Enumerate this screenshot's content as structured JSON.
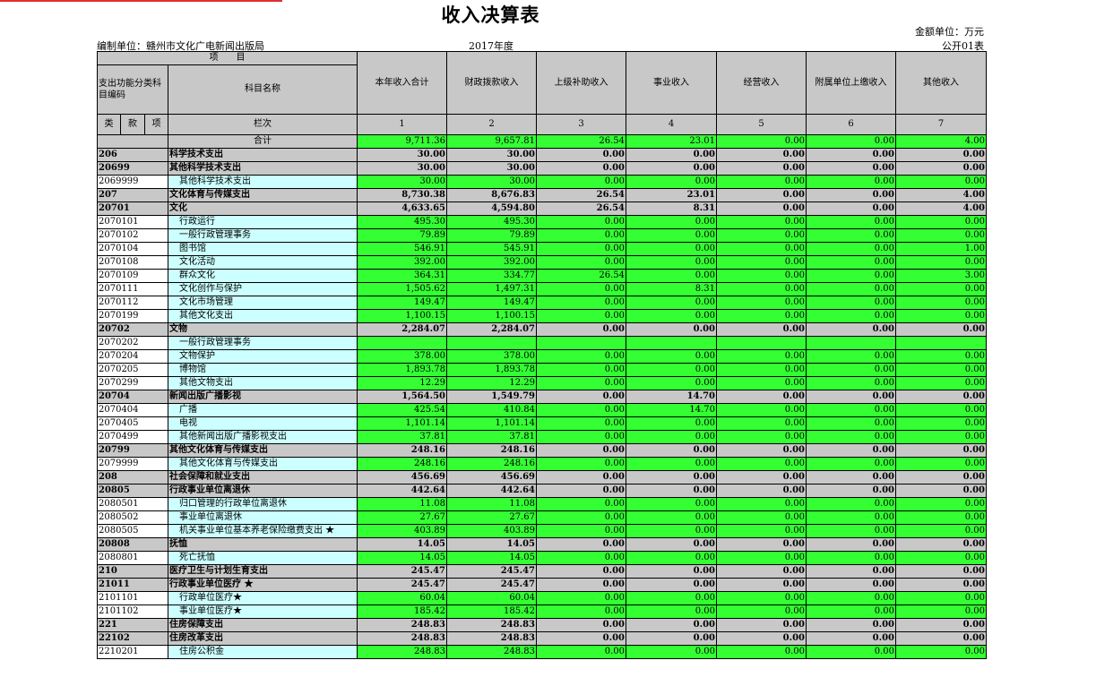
{
  "doc": {
    "title": "收入决算表",
    "unit": "金额单位：万元",
    "org": "编制单位：赣州市文化广电新闻出版局",
    "year": "2017年度",
    "form_no": "公开01表"
  },
  "header": {
    "project": "项　　目",
    "category_code": "支出功能分类科目编码",
    "subject_name": "科目名称",
    "lei": "类",
    "kuan": "款",
    "xiang": "项",
    "lanci": "栏次",
    "columns": [
      "本年收入合计",
      "财政拨款收入",
      "上级补助收入",
      "事业收入",
      "经营收入",
      "附属单位上缴收入",
      "其他收入"
    ],
    "col_nums": [
      "1",
      "2",
      "3",
      "4",
      "5",
      "6",
      "7"
    ]
  },
  "total": {
    "label": "合计",
    "values": [
      "9,711.36",
      "9,657.81",
      "26.54",
      "23.01",
      "0.00",
      "0.00",
      "4.00"
    ]
  },
  "rows": [
    {
      "code": "206",
      "name": "科学技术支出",
      "bold": true,
      "values": [
        "30.00",
        "30.00",
        "0.00",
        "0.00",
        "0.00",
        "0.00",
        "0.00"
      ]
    },
    {
      "code": "20699",
      "name": "其他科学技术支出",
      "bold": true,
      "values": [
        "30.00",
        "30.00",
        "0.00",
        "0.00",
        "0.00",
        "0.00",
        "0.00"
      ]
    },
    {
      "code": "2069999",
      "name": "其他科学技术支出",
      "bold": false,
      "values": [
        "30.00",
        "30.00",
        "0.00",
        "0.00",
        "0.00",
        "0.00",
        "0.00"
      ]
    },
    {
      "code": "207",
      "name": "文化体育与传媒支出",
      "bold": true,
      "values": [
        "8,730.38",
        "8,676.83",
        "26.54",
        "23.01",
        "0.00",
        "0.00",
        "4.00"
      ]
    },
    {
      "code": "20701",
      "name": "文化",
      "bold": true,
      "values": [
        "4,633.65",
        "4,594.80",
        "26.54",
        "8.31",
        "0.00",
        "0.00",
        "4.00"
      ]
    },
    {
      "code": "2070101",
      "name": "行政运行",
      "bold": false,
      "values": [
        "495.30",
        "495.30",
        "0.00",
        "0.00",
        "0.00",
        "0.00",
        "0.00"
      ]
    },
    {
      "code": "2070102",
      "name": "一般行政管理事务",
      "bold": false,
      "values": [
        "79.89",
        "79.89",
        "0.00",
        "0.00",
        "0.00",
        "0.00",
        "0.00"
      ]
    },
    {
      "code": "2070104",
      "name": "图书馆",
      "bold": false,
      "values": [
        "546.91",
        "545.91",
        "0.00",
        "0.00",
        "0.00",
        "0.00",
        "1.00"
      ]
    },
    {
      "code": "2070108",
      "name": "文化活动",
      "bold": false,
      "values": [
        "392.00",
        "392.00",
        "0.00",
        "0.00",
        "0.00",
        "0.00",
        "0.00"
      ]
    },
    {
      "code": "2070109",
      "name": "群众文化",
      "bold": false,
      "values": [
        "364.31",
        "334.77",
        "26.54",
        "0.00",
        "0.00",
        "0.00",
        "3.00"
      ]
    },
    {
      "code": "2070111",
      "name": "文化创作与保护",
      "bold": false,
      "values": [
        "1,505.62",
        "1,497.31",
        "0.00",
        "8.31",
        "0.00",
        "0.00",
        "0.00"
      ]
    },
    {
      "code": "2070112",
      "name": "文化市场管理",
      "bold": false,
      "values": [
        "149.47",
        "149.47",
        "0.00",
        "0.00",
        "0.00",
        "0.00",
        "0.00"
      ]
    },
    {
      "code": "2070199",
      "name": "其他文化支出",
      "bold": false,
      "values": [
        "1,100.15",
        "1,100.15",
        "0.00",
        "0.00",
        "0.00",
        "0.00",
        "0.00"
      ]
    },
    {
      "code": "20702",
      "name": "文物",
      "bold": true,
      "values": [
        "2,284.07",
        "2,284.07",
        "0.00",
        "0.00",
        "0.00",
        "0.00",
        "0.00"
      ]
    },
    {
      "code": "2070202",
      "name": "一般行政管理事务",
      "bold": false,
      "values": [
        "",
        "",
        "",
        "",
        "",
        "",
        ""
      ]
    },
    {
      "code": "2070204",
      "name": "文物保护",
      "bold": false,
      "values": [
        "378.00",
        "378.00",
        "0.00",
        "0.00",
        "0.00",
        "0.00",
        "0.00"
      ]
    },
    {
      "code": "2070205",
      "name": "博物馆",
      "bold": false,
      "values": [
        "1,893.78",
        "1,893.78",
        "0.00",
        "0.00",
        "0.00",
        "0.00",
        "0.00"
      ]
    },
    {
      "code": "2070299",
      "name": "其他文物支出",
      "bold": false,
      "values": [
        "12.29",
        "12.29",
        "0.00",
        "0.00",
        "0.00",
        "0.00",
        "0.00"
      ]
    },
    {
      "code": "20704",
      "name": "新闻出版广播影视",
      "bold": true,
      "values": [
        "1,564.50",
        "1,549.79",
        "0.00",
        "14.70",
        "0.00",
        "0.00",
        "0.00"
      ]
    },
    {
      "code": "2070404",
      "name": "广播",
      "bold": false,
      "values": [
        "425.54",
        "410.84",
        "0.00",
        "14.70",
        "0.00",
        "0.00",
        "0.00"
      ]
    },
    {
      "code": "2070405",
      "name": "电视",
      "bold": false,
      "values": [
        "1,101.14",
        "1,101.14",
        "0.00",
        "0.00",
        "0.00",
        "0.00",
        "0.00"
      ]
    },
    {
      "code": "2070499",
      "name": "其他新闻出版广播影视支出",
      "bold": false,
      "values": [
        "37.81",
        "37.81",
        "0.00",
        "0.00",
        "0.00",
        "0.00",
        "0.00"
      ]
    },
    {
      "code": "20799",
      "name": "其他文化体育与传媒支出",
      "bold": true,
      "values": [
        "248.16",
        "248.16",
        "0.00",
        "0.00",
        "0.00",
        "0.00",
        "0.00"
      ]
    },
    {
      "code": "2079999",
      "name": "其他文化体育与传媒支出",
      "bold": false,
      "values": [
        "248.16",
        "248.16",
        "0.00",
        "0.00",
        "0.00",
        "0.00",
        "0.00"
      ]
    },
    {
      "code": "208",
      "name": "社会保障和就业支出",
      "bold": true,
      "values": [
        "456.69",
        "456.69",
        "0.00",
        "0.00",
        "0.00",
        "0.00",
        "0.00"
      ]
    },
    {
      "code": "20805",
      "name": "行政事业单位离退休",
      "bold": true,
      "values": [
        "442.64",
        "442.64",
        "0.00",
        "0.00",
        "0.00",
        "0.00",
        "0.00"
      ]
    },
    {
      "code": "2080501",
      "name": "归口管理的行政单位离退休",
      "bold": false,
      "values": [
        "11.08",
        "11.08",
        "0.00",
        "0.00",
        "0.00",
        "0.00",
        "0.00"
      ]
    },
    {
      "code": "2080502",
      "name": "事业单位离退休",
      "bold": false,
      "values": [
        "27.67",
        "27.67",
        "0.00",
        "0.00",
        "0.00",
        "0.00",
        "0.00"
      ]
    },
    {
      "code": "2080505",
      "name": "机关事业单位基本养老保险缴费支出 ★",
      "bold": false,
      "values": [
        "403.89",
        "403.89",
        "0.00",
        "0.00",
        "0.00",
        "0.00",
        "0.00"
      ]
    },
    {
      "code": "20808",
      "name": "抚恤",
      "bold": true,
      "values": [
        "14.05",
        "14.05",
        "0.00",
        "0.00",
        "0.00",
        "0.00",
        "0.00"
      ]
    },
    {
      "code": "2080801",
      "name": "死亡抚恤",
      "bold": false,
      "values": [
        "14.05",
        "14.05",
        "0.00",
        "0.00",
        "0.00",
        "0.00",
        "0.00"
      ]
    },
    {
      "code": "210",
      "name": "医疗卫生与计划生育支出",
      "bold": true,
      "values": [
        "245.47",
        "245.47",
        "0.00",
        "0.00",
        "0.00",
        "0.00",
        "0.00"
      ]
    },
    {
      "code": "21011",
      "name": "行政事业单位医疗 ★",
      "bold": true,
      "values": [
        "245.47",
        "245.47",
        "0.00",
        "0.00",
        "0.00",
        "0.00",
        "0.00"
      ]
    },
    {
      "code": "2101101",
      "name": "行政单位医疗★",
      "bold": false,
      "values": [
        "60.04",
        "60.04",
        "0.00",
        "0.00",
        "0.00",
        "0.00",
        "0.00"
      ]
    },
    {
      "code": "2101102",
      "name": "事业单位医疗★",
      "bold": false,
      "values": [
        "185.42",
        "185.42",
        "0.00",
        "0.00",
        "0.00",
        "0.00",
        "0.00"
      ]
    },
    {
      "code": "221",
      "name": "住房保障支出",
      "bold": true,
      "values": [
        "248.83",
        "248.83",
        "0.00",
        "0.00",
        "0.00",
        "0.00",
        "0.00"
      ]
    },
    {
      "code": "22102",
      "name": "住房改革支出",
      "bold": true,
      "values": [
        "248.83",
        "248.83",
        "0.00",
        "0.00",
        "0.00",
        "0.00",
        "0.00"
      ]
    },
    {
      "code": "2210201",
      "name": "住房公积金",
      "bold": false,
      "values": [
        "248.83",
        "248.83",
        "0.00",
        "0.00",
        "0.00",
        "0.00",
        "0.00"
      ]
    }
  ]
}
